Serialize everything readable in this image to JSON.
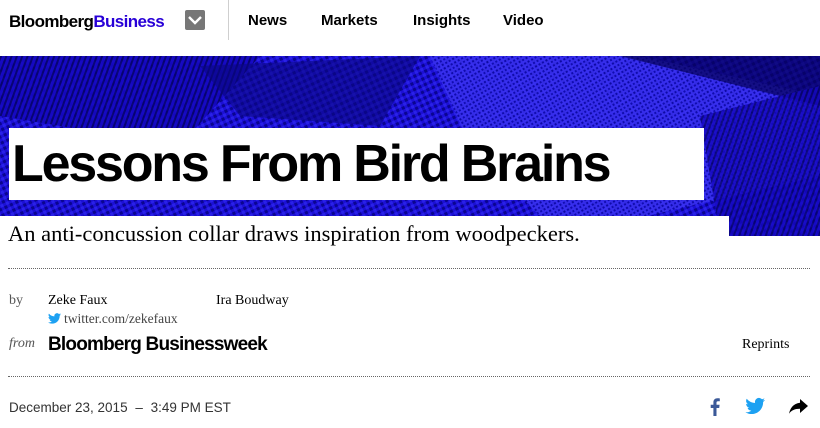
{
  "brand": {
    "logo_part1": "Bloomberg",
    "logo_part2": "Business",
    "logo_accent": "#2800d7"
  },
  "nav": {
    "menu_icon": "chevron-down-icon",
    "links": [
      "News",
      "Markets",
      "Insights",
      "Video"
    ]
  },
  "hero": {
    "background_color": "#1a0fd0",
    "headline": "Lessons From Bird Brains",
    "dek": "An anti-concussion collar draws inspiration from woodpeckers."
  },
  "byline": {
    "by_label": "by",
    "authors": [
      {
        "name": "Zeke Faux",
        "twitter": "twitter.com/zekefaux"
      },
      {
        "name": "Ira Boudway"
      }
    ],
    "from_label": "from",
    "publication": "Bloomberg Businessweek",
    "reprints_label": "Reprints"
  },
  "article_meta": {
    "date": "December 23, 2015",
    "separator": "–",
    "time": "3:49 PM EST"
  },
  "share": {
    "icons": [
      "facebook-icon",
      "twitter-icon",
      "share-arrow-icon"
    ],
    "facebook_color": "#3b5998",
    "twitter_color": "#1da1f2"
  }
}
